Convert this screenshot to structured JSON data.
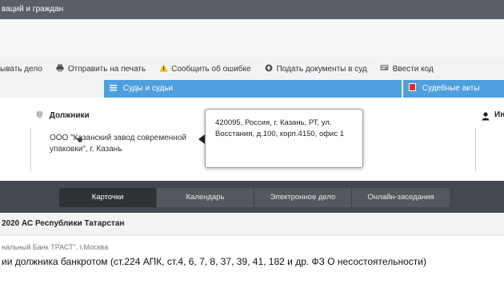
{
  "header": {
    "title": "ваций и граждан"
  },
  "toolbar": {
    "items": [
      {
        "icon": "none",
        "label": "ывать дело"
      },
      {
        "icon": "printer-icon",
        "label": "Отправить на печать"
      },
      {
        "icon": "warning-icon",
        "label": "Сообщить об ошибке"
      },
      {
        "icon": "upload-icon",
        "label": "Подать документы в суд"
      },
      {
        "icon": "keyboard-icon",
        "label": "Ввести код"
      }
    ]
  },
  "tabs": {
    "courts": {
      "label": "Суды и судьи"
    },
    "acts": {
      "label": "Судебные акты"
    }
  },
  "parties": {
    "debtors_heading": "Должники",
    "debtor_name": "ООО \"Казанский завод современной упаковки\", г. Казань",
    "others_heading": "Ин"
  },
  "popover": {
    "address": "420095, Россия, г. Казань, РТ, ул. Восстания, д.100, корп.4150, офис 1"
  },
  "nav": {
    "tabs": [
      {
        "label": "Карточки",
        "active": true
      },
      {
        "label": "Календарь",
        "active": false
      },
      {
        "label": "Электронное дело",
        "active": false
      },
      {
        "label": "Онлайн-заседания",
        "active": false
      }
    ]
  },
  "case": {
    "court_line": "2020 АС Республики Татарстан",
    "claimant": "нальный Банк ТРАСТ\", г.Москва",
    "subject": "ии должника банкротом (ст.224 АПК, ст.4, 6, 7, 8, 37, 39, 41, 182 и др. ФЗ О несостоятельности)"
  },
  "colors": {
    "accent_blue": "#4d9fdd",
    "dark_bar": "#45484f",
    "top_bar": "#5a5e66"
  }
}
